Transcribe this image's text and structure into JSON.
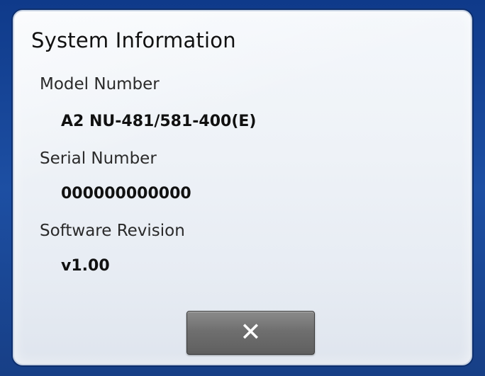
{
  "dialog": {
    "title": "System Information",
    "fields": [
      {
        "label": "Model Number",
        "value": "A2 NU-481/581-400(E)"
      },
      {
        "label": "Serial Number",
        "value": "000000000000"
      },
      {
        "label": "Software Revision",
        "value": "v1.00"
      }
    ],
    "close_button": {
      "icon": "close-icon",
      "glyph": "✕"
    }
  },
  "colors": {
    "frame": "#173f86",
    "dialog_background": "#eef2f7",
    "button": "#6f6f6f",
    "text": "#111111"
  }
}
